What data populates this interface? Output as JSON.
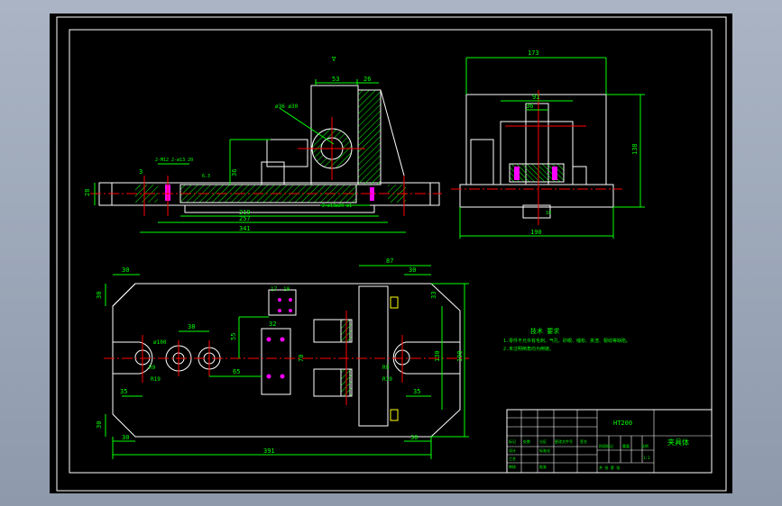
{
  "colors": {
    "background": "#9aa5b6",
    "sheet": "#000000",
    "line": "#ffffff",
    "dimension": "#00ff00",
    "centerline": "#ff0000",
    "hatch": "#00ff00",
    "accent_yellow": "#ffff00",
    "accent_magenta": "#ff00ff"
  },
  "front_view": {
    "dims": {
      "d53": "53",
      "d26": "26",
      "d28": "28",
      "d36": "36",
      "d219": "219",
      "d257": "257",
      "d341": "341",
      "d3": "3",
      "d12": "12",
      "hole_note_left": "2-M12 2-ø13 20",
      "hole_note_right": "2-ø13ø20 ø1",
      "diameter_note": "ø36 ø30",
      "surface_mark": "6.3",
      "mark_top": "∇"
    }
  },
  "side_view": {
    "dims": {
      "d173": "173",
      "d91": "91",
      "d36": "36",
      "d138": "138",
      "d190": "190",
      "d10": "10",
      "d8": "ø"
    }
  },
  "plan_view": {
    "dims": {
      "d30_tl": "30",
      "d30_tl_v": "30",
      "d30_tr": "30",
      "d87": "87",
      "d33": "33",
      "d38": "38",
      "d100": "ø100",
      "d55": "55",
      "d65": "65",
      "d32": "32",
      "d17": "17",
      "d10": "10",
      "d70": "70",
      "r19_l": "R9",
      "r19b_l": "R19",
      "r19_r": "R9",
      "r19b_r": "R19",
      "d35_l": "35",
      "d35_r": "35",
      "d130": "130",
      "d190": "190",
      "d30_bl": "30",
      "d30_bl_v": "30",
      "d30_br": "30",
      "d391": "391"
    }
  },
  "notes": {
    "title": "技术  要求",
    "line1": "1.零件不允许有毛刺、气孔、砂眼、缩松、夹渣、裂纹等缺陷。",
    "line2": "2.未注明倒角均为倒链。"
  },
  "title_block": {
    "drawing_no": "HT200",
    "name": "夹具体",
    "design": "设计",
    "check": "审核",
    "craft": "工艺",
    "standard": "标准化",
    "approve": "批准",
    "stage": "阶段标记",
    "weight": "重量",
    "scale": "比例",
    "scale_value": "1:1",
    "sheet": "共  张  第  张",
    "mark": "标记",
    "count": "处数",
    "zone": "分区",
    "change_doc": "更改文件号",
    "signature": "签名"
  }
}
